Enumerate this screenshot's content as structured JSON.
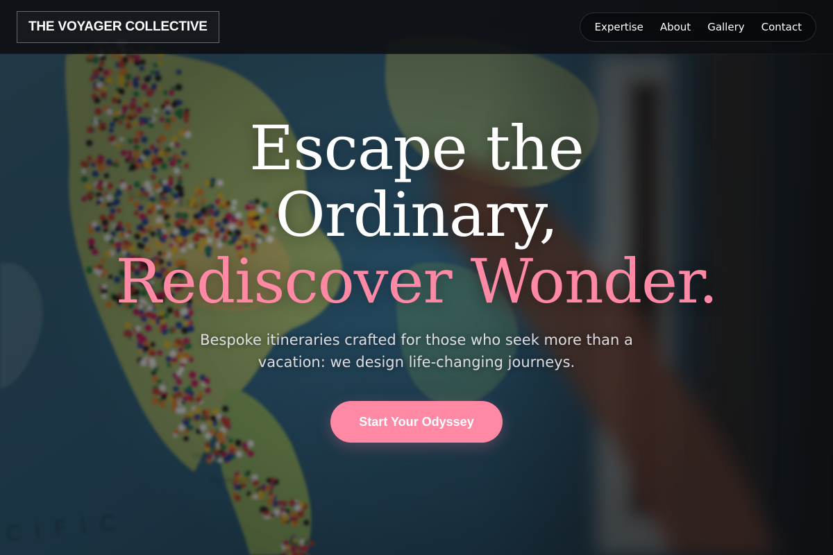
{
  "brand": {
    "name": "THE VOYAGER COLLECTIVE"
  },
  "nav": {
    "items": [
      {
        "label": "Expertise"
      },
      {
        "label": "About"
      },
      {
        "label": "Gallery"
      },
      {
        "label": "Contact"
      }
    ]
  },
  "hero": {
    "headline_line1": "Escape the",
    "headline_line2": "Ordinary,",
    "headline_accent": "Rediscover Wonder.",
    "subtitle": "Bespoke itineraries crafted for those who seek more than a vacation: we design life-changing journeys.",
    "cta_label": "Start Your Odyssey",
    "background_description_icon": "world-map-with-pins-photo"
  },
  "colors": {
    "accent": "#ff88a5",
    "header_bg": "#0e0f11",
    "text": "#ffffff"
  }
}
